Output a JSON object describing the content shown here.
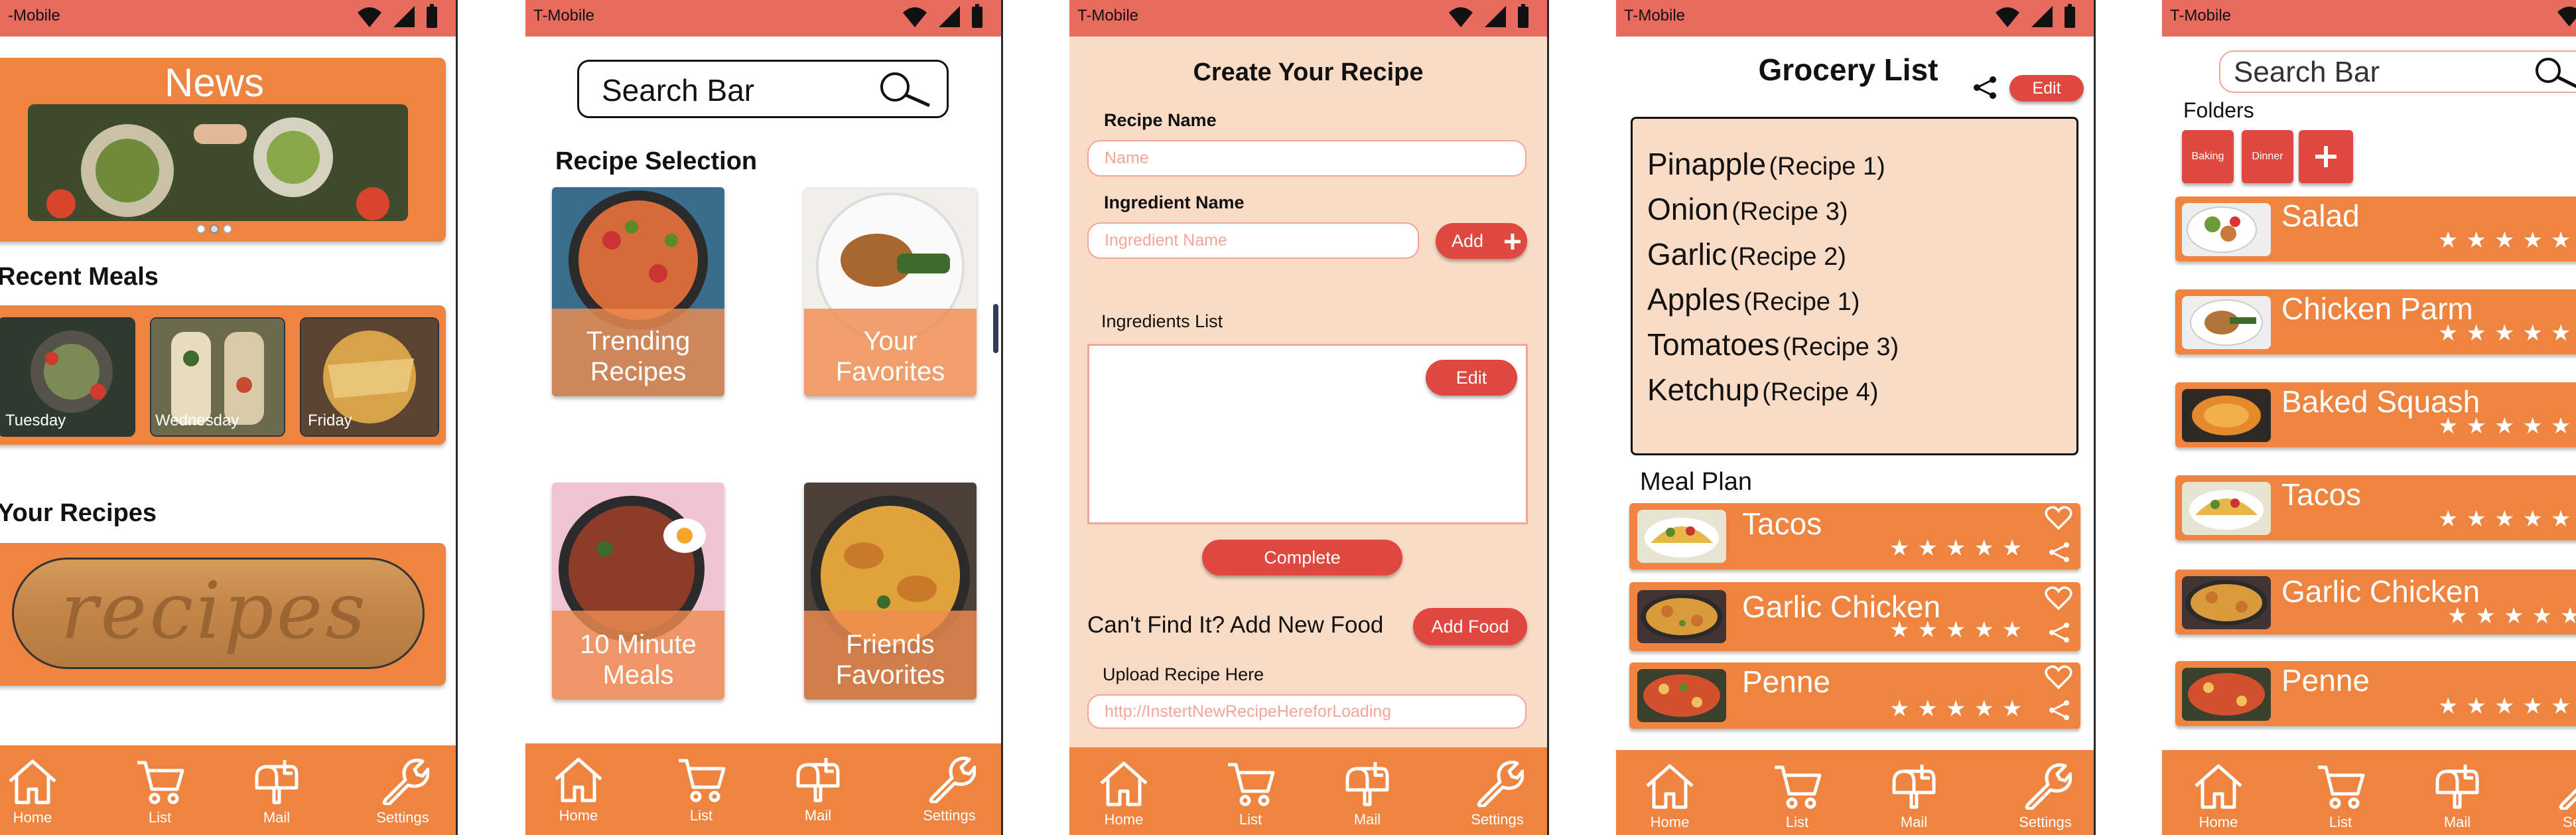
{
  "status": {
    "carrier": "T-Mobile",
    "carrier_cut": "-Mobile"
  },
  "nav": {
    "home": "Home",
    "list": "List",
    "mail": "Mail",
    "settings": "Settings",
    "settings_cut": "Se"
  },
  "colors": {
    "status": "#e96a5e",
    "accent": "#ee8440",
    "button": "#e0483f",
    "form_bg": "#f9dbc6"
  },
  "s1": {
    "news_title": "News",
    "recent_title": "Recent Meals",
    "recent": [
      {
        "day": "Tuesday"
      },
      {
        "day": "Wednesday"
      },
      {
        "day": "Friday"
      }
    ],
    "your_recipes_title": "Your Recipes",
    "recipes_logo_text": "recipes"
  },
  "s2": {
    "search_label": "Search Bar",
    "section_title": "Recipe Selection",
    "tiles": [
      {
        "line1": "Trending",
        "line2": "Recipes"
      },
      {
        "line1": "Your",
        "line2": "Favorites"
      },
      {
        "line1": "10 Minute",
        "line2": "Meals"
      },
      {
        "line1": "Friends",
        "line2": "Favorites"
      }
    ]
  },
  "s3": {
    "title": "Create Your Recipe",
    "recipe_name_label": "Recipe Name",
    "name_placeholder": "Name",
    "ingredient_label": "Ingredient Name",
    "ingredient_placeholder": "Ingredient Name",
    "add_label": "Add",
    "ingredients_list_label": "Ingredients List",
    "edit_label": "Edit",
    "complete_label": "Complete",
    "cant_find_text": "Can't Find It? Add New Food",
    "add_food_label": "Add Food",
    "upload_label": "Upload Recipe Here",
    "upload_placeholder": "http://InstertNewRecipeHereforLoading"
  },
  "s4": {
    "title": "Grocery List",
    "edit_label": "Edit",
    "groceries": [
      {
        "item": "Pinapple",
        "recipe": "(Recipe 1)"
      },
      {
        "item": "Onion",
        "recipe": "(Recipe 3)"
      },
      {
        "item": "Garlic",
        "recipe": "(Recipe 2)"
      },
      {
        "item": "Apples",
        "recipe": "(Recipe 1)"
      },
      {
        "item": "Tomatoes",
        "recipe": "(Recipe 3)"
      },
      {
        "item": "Ketchup",
        "recipe": "(Recipe 4)"
      }
    ],
    "meal_plan_title": "Meal Plan",
    "meals": [
      {
        "name": "Tacos",
        "rating": 5
      },
      {
        "name": "Garlic Chicken",
        "rating": 5
      },
      {
        "name": "Penne",
        "rating": 5
      }
    ]
  },
  "s5": {
    "search_label": "Search Bar",
    "folders_title": "Folders",
    "folders": [
      {
        "label": "Baking"
      },
      {
        "label": "Dinner"
      }
    ],
    "recipes": [
      {
        "name": "Salad"
      },
      {
        "name": "Chicken Parm"
      },
      {
        "name": "Baked Squash"
      },
      {
        "name": "Tacos"
      },
      {
        "name": "Garlic Chicken"
      },
      {
        "name": "Penne"
      }
    ]
  }
}
